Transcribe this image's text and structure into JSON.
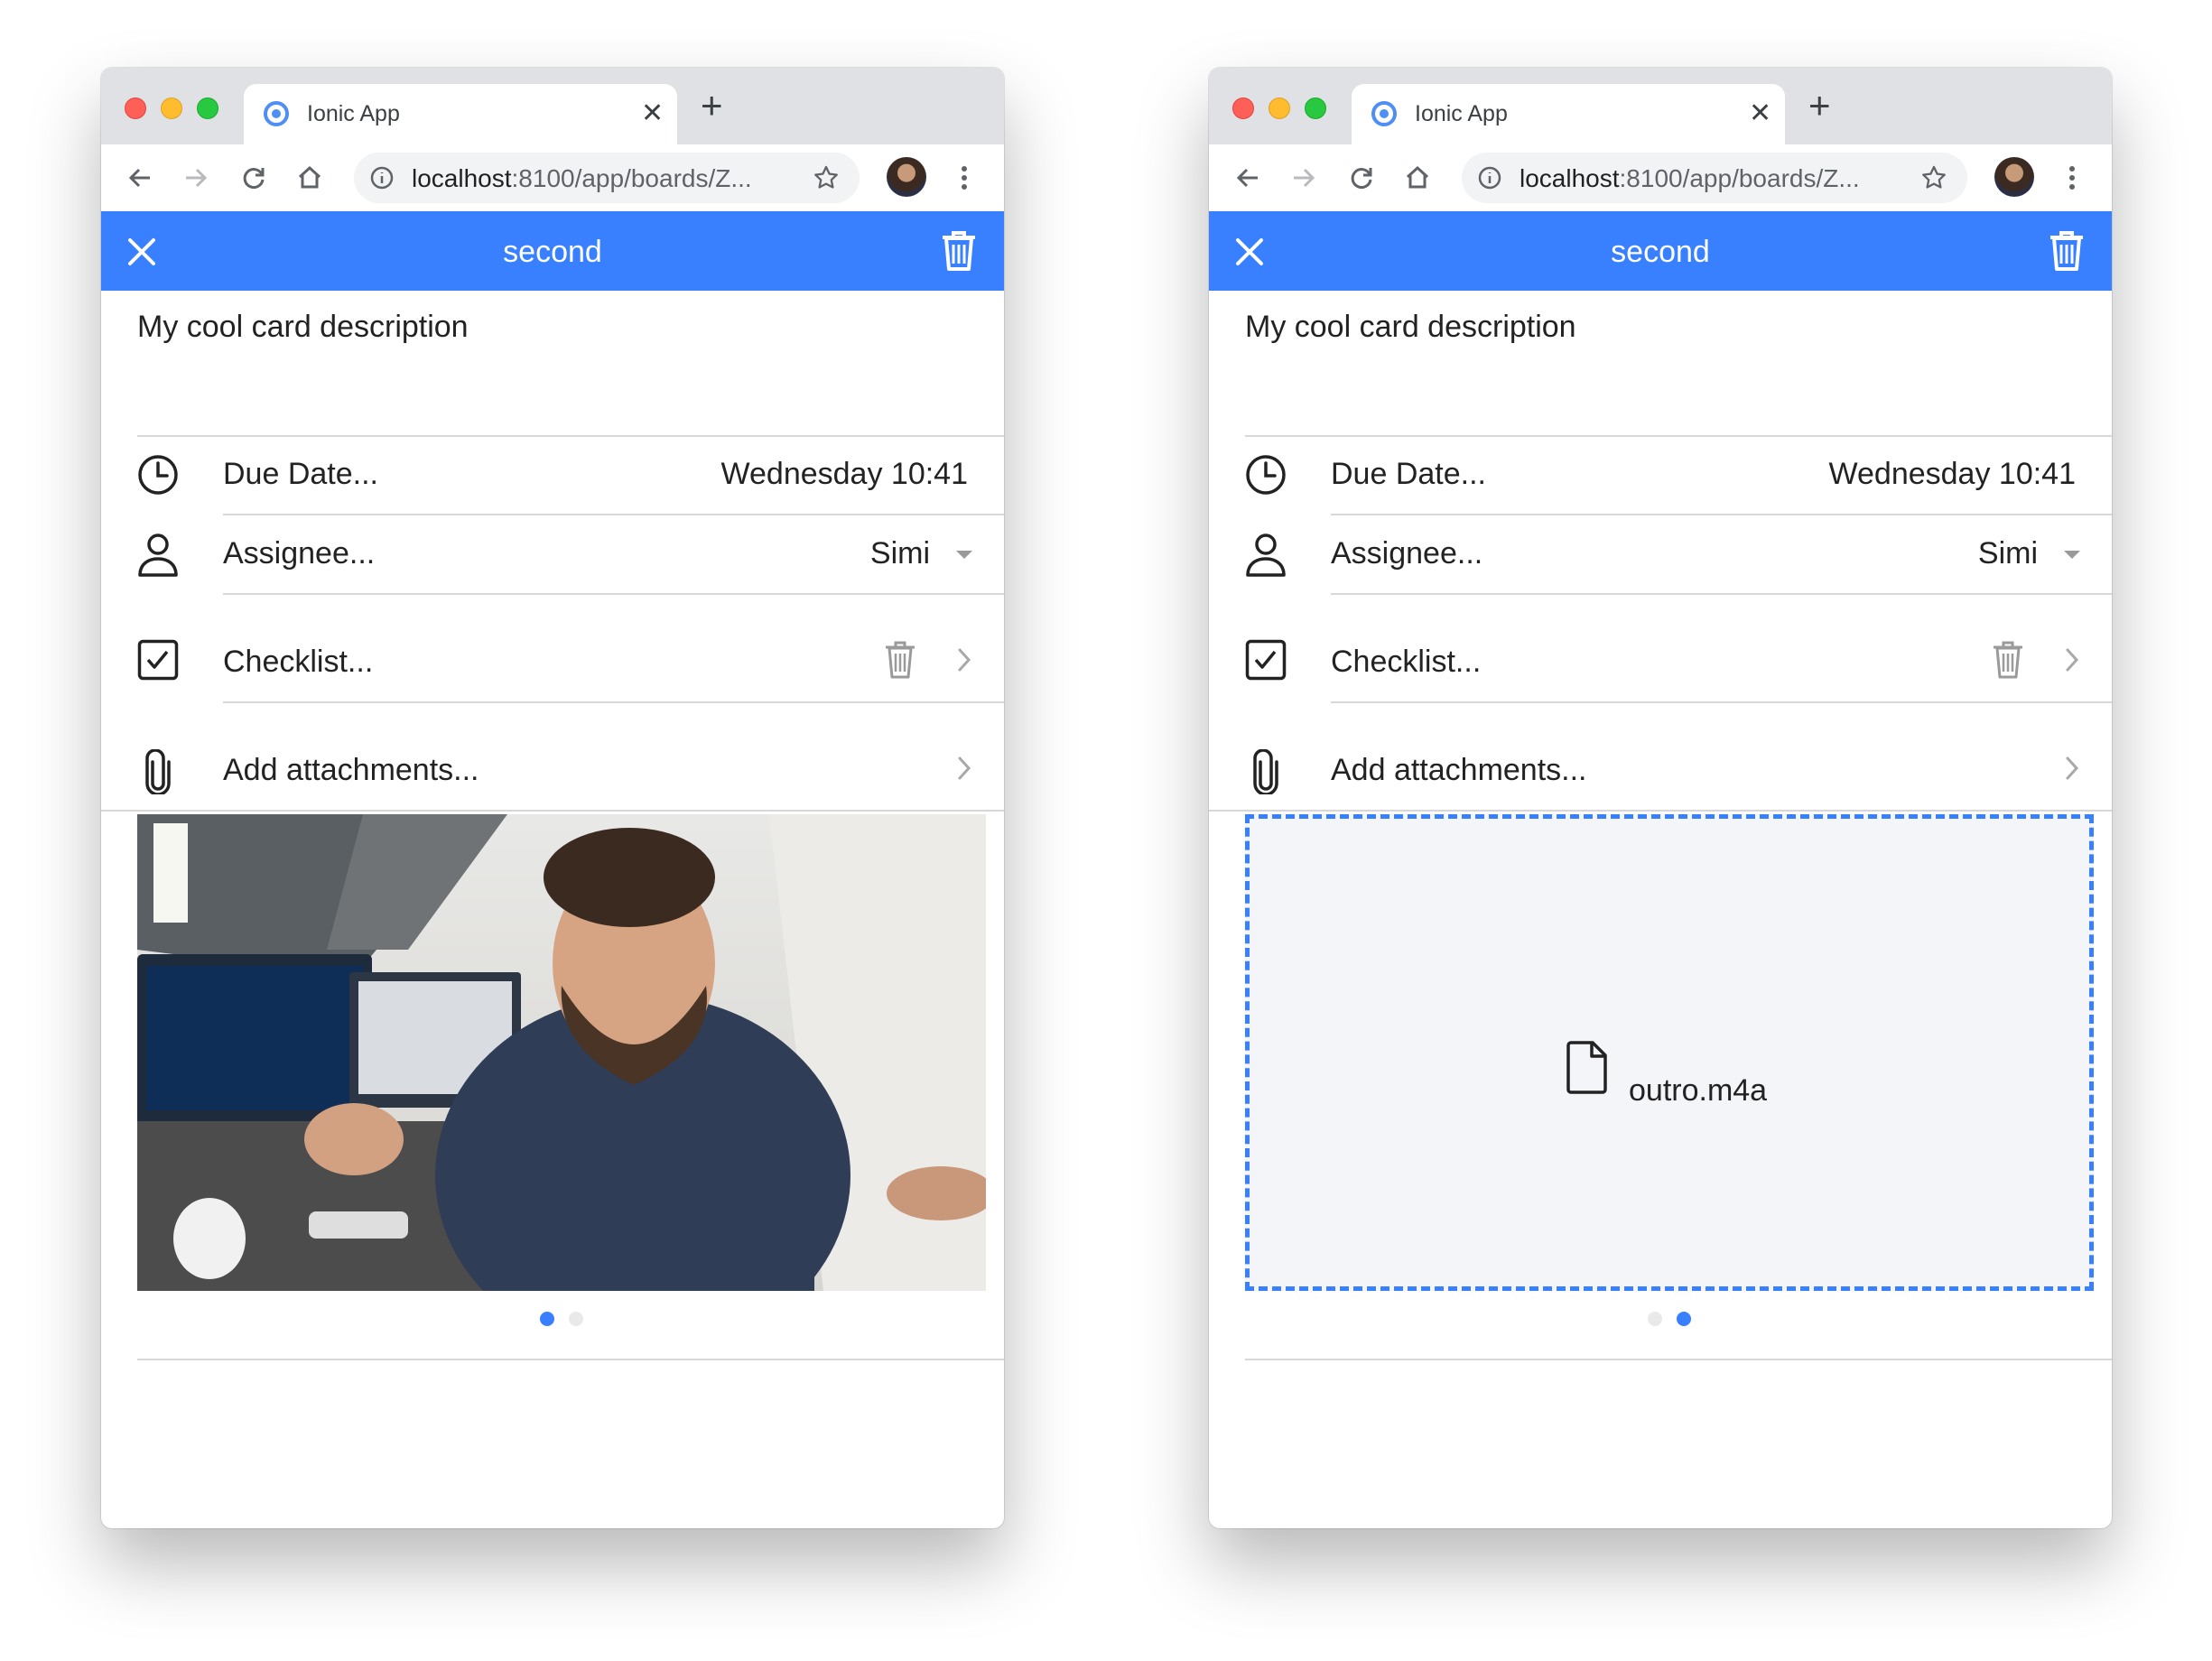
{
  "windows": [
    {
      "tab": {
        "title": "Ionic App"
      },
      "address": {
        "host": "localhost",
        "path": ":8100/app/boards/Z..."
      },
      "header": {
        "title": "second"
      },
      "description": "My cool card description",
      "due_date": {
        "label": "Due Date...",
        "value": "Wednesday 10:41"
      },
      "assignee": {
        "label": "Assignee...",
        "value": "Simi"
      },
      "checklist": {
        "label": "Checklist..."
      },
      "attachments": {
        "label": "Add attachments..."
      },
      "slide": {
        "type": "image",
        "name": ""
      },
      "pager": {
        "count": 2,
        "active": 0
      }
    },
    {
      "tab": {
        "title": "Ionic App"
      },
      "address": {
        "host": "localhost",
        "path": ":8100/app/boards/Z..."
      },
      "header": {
        "title": "second"
      },
      "description": "My cool card description",
      "due_date": {
        "label": "Due Date...",
        "value": "Wednesday 10:41"
      },
      "assignee": {
        "label": "Assignee...",
        "value": "Simi"
      },
      "checklist": {
        "label": "Checklist..."
      },
      "attachments": {
        "label": "Add attachments..."
      },
      "slide": {
        "type": "file",
        "name": "outro.m4a"
      },
      "pager": {
        "count": 2,
        "active": 1
      }
    }
  ],
  "colors": {
    "primary": "#3880ff",
    "divider": "#d7d7d7",
    "text": "#222222"
  },
  "icons": [
    "close-icon",
    "trash-icon",
    "clock-icon",
    "person-icon",
    "checkbox-icon",
    "paperclip-icon",
    "chevron-right-icon",
    "file-icon",
    "back-arrow-icon",
    "forward-arrow-icon",
    "reload-icon",
    "home-icon",
    "info-icon",
    "star-icon",
    "menu-dots-icon"
  ]
}
